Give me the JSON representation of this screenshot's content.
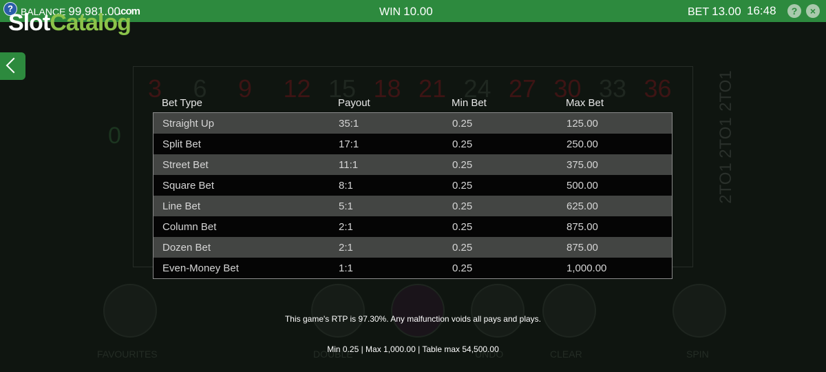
{
  "topbar": {
    "balance_label": "BALANCE",
    "balance_value": "99,981.00",
    "win_label": "WIN",
    "win_value": "10.00",
    "bet_label": "BET",
    "bet_value": "13.00",
    "clock": "16:48",
    "help_icon": "?",
    "close_icon": "×"
  },
  "watermark": {
    "part1": "Slot",
    "part2": "Catalog",
    "part3": ".com"
  },
  "corner_help": "?",
  "paytable": {
    "headers": [
      "Bet Type",
      "Payout",
      "Min Bet",
      "Max Bet"
    ],
    "rows": [
      {
        "type": "Straight Up",
        "payout": "35:1",
        "min": "0.25",
        "max": "125.00"
      },
      {
        "type": "Split Bet",
        "payout": "17:1",
        "min": "0.25",
        "max": "250.00"
      },
      {
        "type": "Street Bet",
        "payout": "11:1",
        "min": "0.25",
        "max": "375.00"
      },
      {
        "type": "Square Bet",
        "payout": "8:1",
        "min": "0.25",
        "max": "500.00"
      },
      {
        "type": "Line Bet",
        "payout": "5:1",
        "min": "0.25",
        "max": "625.00"
      },
      {
        "type": "Column Bet",
        "payout": "2:1",
        "min": "0.25",
        "max": "875.00"
      },
      {
        "type": "Dozen Bet",
        "payout": "2:1",
        "min": "0.25",
        "max": "875.00"
      },
      {
        "type": "Even-Money Bet",
        "payout": "1:1",
        "min": "0.25",
        "max": "1,000.00"
      }
    ]
  },
  "rtp_text": "This game's RTP is 97.30%. Any malfunction voids all pays and plays.",
  "limits_text": "Min 0.25 | Max 1,000.00 | Table max 54,500.00",
  "background": {
    "numbers": [
      {
        "n": "3",
        "red": true
      },
      {
        "n": "6",
        "red": false
      },
      {
        "n": "9",
        "red": true
      },
      {
        "n": "12",
        "red": true
      },
      {
        "n": "15",
        "red": false
      },
      {
        "n": "18",
        "red": true
      },
      {
        "n": "21",
        "red": true
      },
      {
        "n": "24",
        "red": false
      },
      {
        "n": "27",
        "red": true
      },
      {
        "n": "30",
        "red": true
      },
      {
        "n": "33",
        "red": false
      },
      {
        "n": "36",
        "red": true
      }
    ],
    "zero": "0",
    "two_to_one": "2TO1",
    "controls": [
      "FAVOURITES",
      "DOUBLE",
      "UNDO",
      "CLEAR",
      "SPIN"
    ]
  },
  "colors": {
    "topbar": "#2d8a3e",
    "row_alt": "#434543",
    "row": "#050505"
  }
}
